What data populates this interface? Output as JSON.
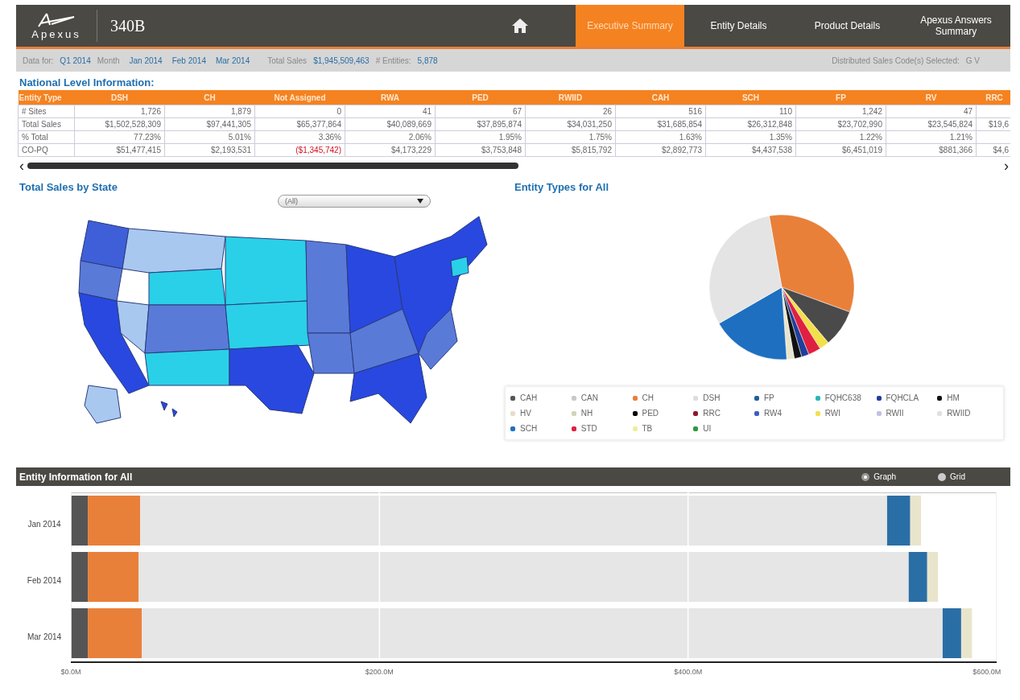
{
  "header": {
    "logo": "Apexus",
    "logo_340b": "340B",
    "tabs": [
      {
        "label": "Executive Summary",
        "selected": true
      },
      {
        "label": "Entity Details",
        "selected": false
      },
      {
        "label": "Product Details",
        "selected": false
      },
      {
        "label": "Apexus Answers Summary",
        "selected": false
      }
    ]
  },
  "filter_bar": {
    "data_for_label": "Data for:",
    "data_for": "Q1 2014",
    "month_label": "Month",
    "months": [
      "Jan 2014",
      "Feb 2014",
      "Mar 2014"
    ],
    "total_sales_label": "Total Sales",
    "total_sales": "$1,945,509,463",
    "entities_label": "# Entities:",
    "entities": "5,878",
    "codes_label": "Distributed Sales Code(s) Selected:",
    "codes": "G V"
  },
  "national": {
    "title": "National Level Information:",
    "scroll_left": "‹",
    "scroll_right": "›",
    "columns": [
      "Entity Type",
      "DSH",
      "CH",
      "Not Assigned",
      "RWA",
      "PED",
      "RWIID",
      "CAH",
      "SCH",
      "FP",
      "RV",
      "RRC"
    ],
    "rows": [
      {
        "cells": [
          {
            "text": "# Sites",
            "negative": false
          },
          {
            "text": "1,726",
            "negative": false
          },
          {
            "text": "1,879",
            "negative": false
          },
          {
            "text": "0",
            "negative": false
          },
          {
            "text": "41",
            "negative": false
          },
          {
            "text": "67",
            "negative": false
          },
          {
            "text": "26",
            "negative": false
          },
          {
            "text": "516",
            "negative": false
          },
          {
            "text": "110",
            "negative": false
          },
          {
            "text": "1,242",
            "negative": false
          },
          {
            "text": "47",
            "negative": false
          }
        ]
      },
      {
        "cells": [
          {
            "text": "Total Sales",
            "negative": false
          },
          {
            "text": "$1,502,528,309",
            "negative": false
          },
          {
            "text": "$97,441,305",
            "negative": false
          },
          {
            "text": "$65,377,864",
            "negative": false
          },
          {
            "text": "$40,089,669",
            "negative": false
          },
          {
            "text": "$37,895,874",
            "negative": false
          },
          {
            "text": "$34,031,250",
            "negative": false
          },
          {
            "text": "$31,685,854",
            "negative": false
          },
          {
            "text": "$26,312,848",
            "negative": false
          },
          {
            "text": "$23,702,990",
            "negative": false
          },
          {
            "text": "$23,545,824",
            "negative": false
          },
          {
            "text": "$19,6",
            "negative": false
          }
        ]
      },
      {
        "cells": [
          {
            "text": "% Total",
            "negative": false
          },
          {
            "text": "77.23%",
            "negative": false
          },
          {
            "text": "5.01%",
            "negative": false
          },
          {
            "text": "3.36%",
            "negative": false
          },
          {
            "text": "2.06%",
            "negative": false
          },
          {
            "text": "1.95%",
            "negative": false
          },
          {
            "text": "1.75%",
            "negative": false
          },
          {
            "text": "1.63%",
            "negative": false
          },
          {
            "text": "1.35%",
            "negative": false
          },
          {
            "text": "1.22%",
            "negative": false
          },
          {
            "text": "1.21%",
            "negative": false
          }
        ]
      },
      {
        "cells": [
          {
            "text": "CO-PQ",
            "negative": false
          },
          {
            "text": "$51,477,415",
            "negative": false
          },
          {
            "text": "$2,193,531",
            "negative": false
          },
          {
            "text": "($1,345,742)",
            "negative": true
          },
          {
            "text": "$4,173,229",
            "negative": false
          },
          {
            "text": "$3,753,848",
            "negative": false
          },
          {
            "text": "$5,815,792",
            "negative": false
          },
          {
            "text": "$2,892,773",
            "negative": false
          },
          {
            "text": "$4,437,538",
            "negative": false
          },
          {
            "text": "$6,451,019",
            "negative": false
          },
          {
            "text": "$881,366",
            "negative": false
          },
          {
            "text": "$4,6",
            "negative": false
          }
        ]
      }
    ]
  },
  "sales_by_state": {
    "title": "Total Sales by State",
    "dropdown": "(All)"
  },
  "entity_types": {
    "title": "Entity Types for All",
    "legend": [
      {
        "label": "CAH",
        "color": "#555555"
      },
      {
        "label": "CAN",
        "color": "#c8c8c8"
      },
      {
        "label": "CH",
        "color": "#e8803a"
      },
      {
        "label": "DSH",
        "color": "#dddddd"
      },
      {
        "label": "FP",
        "color": "#1f5f9a"
      },
      {
        "label": "FQHC638",
        "color": "#2ab5b5"
      },
      {
        "label": "FQHCLA",
        "color": "#1f3f9a"
      },
      {
        "label": "HM",
        "color": "#111111"
      },
      {
        "label": "HV",
        "color": "#e8dcc8"
      },
      {
        "label": "NH",
        "color": "#cdd6b8"
      },
      {
        "label": "PED",
        "color": "#000000"
      },
      {
        "label": "RRC",
        "color": "#8b1a2a"
      },
      {
        "label": "RW4",
        "color": "#3b5fc0"
      },
      {
        "label": "RWI",
        "color": "#f2e04a"
      },
      {
        "label": "RWII",
        "color": "#c0c0e0"
      },
      {
        "label": "RWIID",
        "color": "#e0e0e0"
      },
      {
        "label": "SCH",
        "color": "#1e6fc0"
      },
      {
        "label": "STD",
        "color": "#e02040"
      },
      {
        "label": "TB",
        "color": "#eeee99"
      },
      {
        "label": "UI",
        "color": "#2a9a3a"
      }
    ]
  },
  "entity_info": {
    "title": "Entity Information for All",
    "views": [
      {
        "label": "Graph",
        "selected": true
      },
      {
        "label": "Grid",
        "selected": false
      }
    ],
    "chart_data": {
      "type": "bar",
      "orientation": "horizontal",
      "stacked": true,
      "categories": [
        "Jan 2014",
        "Feb 2014",
        "Mar 2014"
      ],
      "series": [
        {
          "color": "#555555",
          "values": [
            11,
            11,
            11
          ]
        },
        {
          "color": "#e8803a",
          "values": [
            34,
            33,
            35
          ]
        },
        {
          "color": "#e6e6e6",
          "values": [
            484,
            499,
            519
          ]
        },
        {
          "color": "#2a6ea6",
          "values": [
            15,
            12,
            12
          ]
        },
        {
          "color": "#e9e5cc",
          "values": [
            7,
            7,
            7
          ]
        }
      ],
      "xlim": [
        0,
        600
      ],
      "xticks": [
        {
          "value": 0,
          "label": "$0.0M"
        },
        {
          "value": 200,
          "label": "$200.0M"
        },
        {
          "value": 400,
          "label": "$400.0M"
        },
        {
          "value": 600,
          "label": "$600.0M"
        }
      ]
    }
  }
}
